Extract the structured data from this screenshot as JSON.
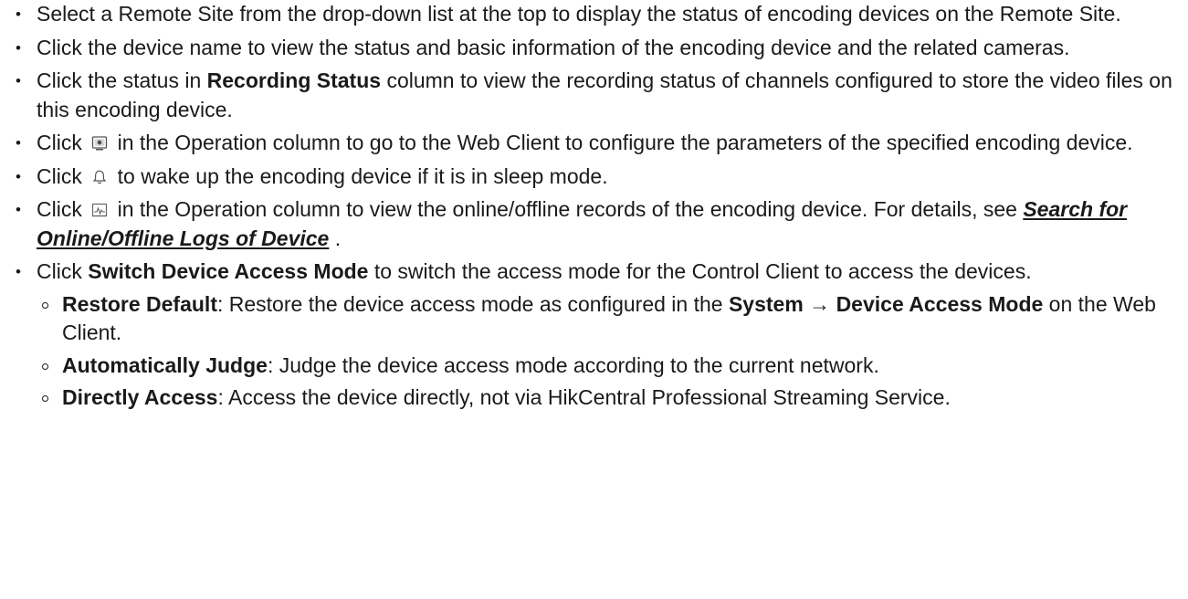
{
  "items": [
    {
      "text": "Select a Remote Site from the drop-down list at the top to display the status of encoding devices on the Remote Site."
    },
    {
      "text": "Click the device name to view the status and basic information of the encoding device and the related cameras."
    },
    {
      "pre": "Click the status in ",
      "bold": "Recording Status",
      "post": " column to view the recording status of channels configured to store the video files on this encoding device."
    },
    {
      "pre": "Click",
      "icon": "web-client-icon",
      "post": "in the Operation column to go to the Web Client to configure the parameters of the specified encoding device."
    },
    {
      "pre": "Click",
      "icon": "bell-icon",
      "post": "to wake up the encoding device if it is in sleep mode."
    },
    {
      "pre": "Click",
      "icon": "online-records-icon",
      "post": "in the Operation column to view the online/offline records of the encoding device. For details, see ",
      "link": "Search for Online/Offline Logs of Device",
      "after_link": " ."
    },
    {
      "pre": "Click ",
      "bold": "Switch Device Access Mode",
      "post": " to switch the access mode for the Control Client to access the devices.",
      "sub": [
        {
          "bold": "Restore Default",
          "text1": ": Restore the device access mode as configured in the ",
          "bold2": "System → Device Access Mode",
          "text2": " on the Web Client."
        },
        {
          "bold": "Automatically Judge",
          "text1": ": Judge the device access mode according to the current network."
        },
        {
          "bold": "Directly Access",
          "text1": ": Access the device directly, not via HikCentral Professional Streaming Service."
        }
      ]
    }
  ]
}
